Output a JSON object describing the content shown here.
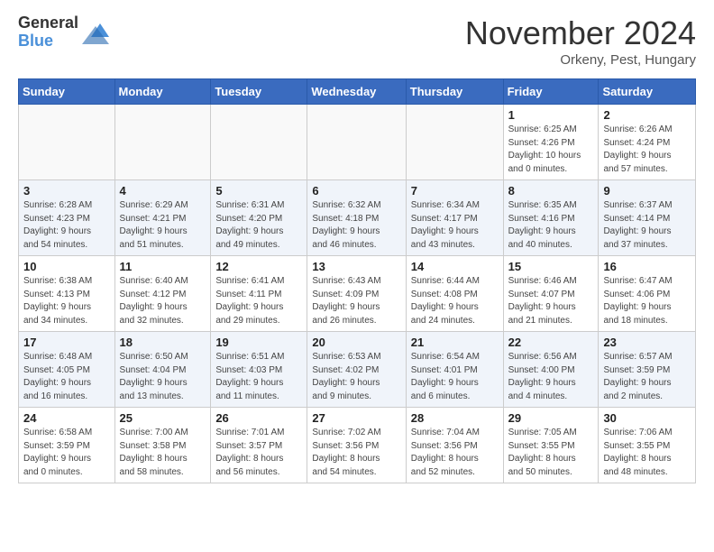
{
  "header": {
    "logo_general": "General",
    "logo_blue": "Blue",
    "month_title": "November 2024",
    "location": "Orkeny, Pest, Hungary"
  },
  "weekdays": [
    "Sunday",
    "Monday",
    "Tuesday",
    "Wednesday",
    "Thursday",
    "Friday",
    "Saturday"
  ],
  "weeks": [
    [
      {
        "day": "",
        "info": ""
      },
      {
        "day": "",
        "info": ""
      },
      {
        "day": "",
        "info": ""
      },
      {
        "day": "",
        "info": ""
      },
      {
        "day": "",
        "info": ""
      },
      {
        "day": "1",
        "info": "Sunrise: 6:25 AM\nSunset: 4:26 PM\nDaylight: 10 hours\nand 0 minutes."
      },
      {
        "day": "2",
        "info": "Sunrise: 6:26 AM\nSunset: 4:24 PM\nDaylight: 9 hours\nand 57 minutes."
      }
    ],
    [
      {
        "day": "3",
        "info": "Sunrise: 6:28 AM\nSunset: 4:23 PM\nDaylight: 9 hours\nand 54 minutes."
      },
      {
        "day": "4",
        "info": "Sunrise: 6:29 AM\nSunset: 4:21 PM\nDaylight: 9 hours\nand 51 minutes."
      },
      {
        "day": "5",
        "info": "Sunrise: 6:31 AM\nSunset: 4:20 PM\nDaylight: 9 hours\nand 49 minutes."
      },
      {
        "day": "6",
        "info": "Sunrise: 6:32 AM\nSunset: 4:18 PM\nDaylight: 9 hours\nand 46 minutes."
      },
      {
        "day": "7",
        "info": "Sunrise: 6:34 AM\nSunset: 4:17 PM\nDaylight: 9 hours\nand 43 minutes."
      },
      {
        "day": "8",
        "info": "Sunrise: 6:35 AM\nSunset: 4:16 PM\nDaylight: 9 hours\nand 40 minutes."
      },
      {
        "day": "9",
        "info": "Sunrise: 6:37 AM\nSunset: 4:14 PM\nDaylight: 9 hours\nand 37 minutes."
      }
    ],
    [
      {
        "day": "10",
        "info": "Sunrise: 6:38 AM\nSunset: 4:13 PM\nDaylight: 9 hours\nand 34 minutes."
      },
      {
        "day": "11",
        "info": "Sunrise: 6:40 AM\nSunset: 4:12 PM\nDaylight: 9 hours\nand 32 minutes."
      },
      {
        "day": "12",
        "info": "Sunrise: 6:41 AM\nSunset: 4:11 PM\nDaylight: 9 hours\nand 29 minutes."
      },
      {
        "day": "13",
        "info": "Sunrise: 6:43 AM\nSunset: 4:09 PM\nDaylight: 9 hours\nand 26 minutes."
      },
      {
        "day": "14",
        "info": "Sunrise: 6:44 AM\nSunset: 4:08 PM\nDaylight: 9 hours\nand 24 minutes."
      },
      {
        "day": "15",
        "info": "Sunrise: 6:46 AM\nSunset: 4:07 PM\nDaylight: 9 hours\nand 21 minutes."
      },
      {
        "day": "16",
        "info": "Sunrise: 6:47 AM\nSunset: 4:06 PM\nDaylight: 9 hours\nand 18 minutes."
      }
    ],
    [
      {
        "day": "17",
        "info": "Sunrise: 6:48 AM\nSunset: 4:05 PM\nDaylight: 9 hours\nand 16 minutes."
      },
      {
        "day": "18",
        "info": "Sunrise: 6:50 AM\nSunset: 4:04 PM\nDaylight: 9 hours\nand 13 minutes."
      },
      {
        "day": "19",
        "info": "Sunrise: 6:51 AM\nSunset: 4:03 PM\nDaylight: 9 hours\nand 11 minutes."
      },
      {
        "day": "20",
        "info": "Sunrise: 6:53 AM\nSunset: 4:02 PM\nDaylight: 9 hours\nand 9 minutes."
      },
      {
        "day": "21",
        "info": "Sunrise: 6:54 AM\nSunset: 4:01 PM\nDaylight: 9 hours\nand 6 minutes."
      },
      {
        "day": "22",
        "info": "Sunrise: 6:56 AM\nSunset: 4:00 PM\nDaylight: 9 hours\nand 4 minutes."
      },
      {
        "day": "23",
        "info": "Sunrise: 6:57 AM\nSunset: 3:59 PM\nDaylight: 9 hours\nand 2 minutes."
      }
    ],
    [
      {
        "day": "24",
        "info": "Sunrise: 6:58 AM\nSunset: 3:59 PM\nDaylight: 9 hours\nand 0 minutes."
      },
      {
        "day": "25",
        "info": "Sunrise: 7:00 AM\nSunset: 3:58 PM\nDaylight: 8 hours\nand 58 minutes."
      },
      {
        "day": "26",
        "info": "Sunrise: 7:01 AM\nSunset: 3:57 PM\nDaylight: 8 hours\nand 56 minutes."
      },
      {
        "day": "27",
        "info": "Sunrise: 7:02 AM\nSunset: 3:56 PM\nDaylight: 8 hours\nand 54 minutes."
      },
      {
        "day": "28",
        "info": "Sunrise: 7:04 AM\nSunset: 3:56 PM\nDaylight: 8 hours\nand 52 minutes."
      },
      {
        "day": "29",
        "info": "Sunrise: 7:05 AM\nSunset: 3:55 PM\nDaylight: 8 hours\nand 50 minutes."
      },
      {
        "day": "30",
        "info": "Sunrise: 7:06 AM\nSunset: 3:55 PM\nDaylight: 8 hours\nand 48 minutes."
      }
    ]
  ]
}
